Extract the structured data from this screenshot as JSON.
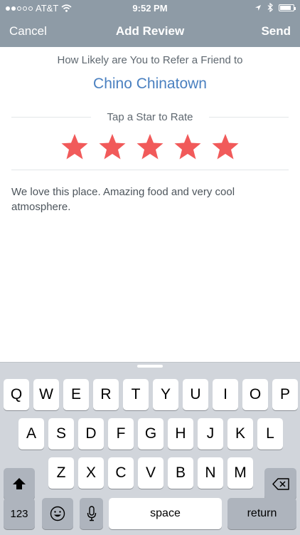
{
  "status_bar": {
    "signal_filled": 2,
    "signal_total": 5,
    "carrier": "AT&T",
    "time": "9:52 PM",
    "battery_level": 0.85
  },
  "nav": {
    "left": "Cancel",
    "title": "Add Review",
    "right": "Send"
  },
  "content": {
    "prompt": "How Likely are You to Refer a Friend to",
    "restaurant": "Chino Chinatown",
    "rate_label": "Tap a Star to Rate",
    "rating": 5,
    "rating_max": 5,
    "review_text": "We love this place. Amazing food and very cool atmosphere."
  },
  "colors": {
    "header": "#8e9ba6",
    "accent": "#4a80c0",
    "star": "#f15a5a"
  },
  "keyboard": {
    "row1": [
      "Q",
      "W",
      "E",
      "R",
      "T",
      "Y",
      "U",
      "I",
      "O",
      "P"
    ],
    "row2": [
      "A",
      "S",
      "D",
      "F",
      "G",
      "H",
      "J",
      "K",
      "L"
    ],
    "row3": [
      "Z",
      "X",
      "C",
      "V",
      "B",
      "N",
      "M"
    ],
    "numbers": "123",
    "space": "space",
    "return": "return",
    "icons": [
      "shift-icon",
      "backspace-icon",
      "emoji-icon",
      "microphone-icon"
    ]
  }
}
